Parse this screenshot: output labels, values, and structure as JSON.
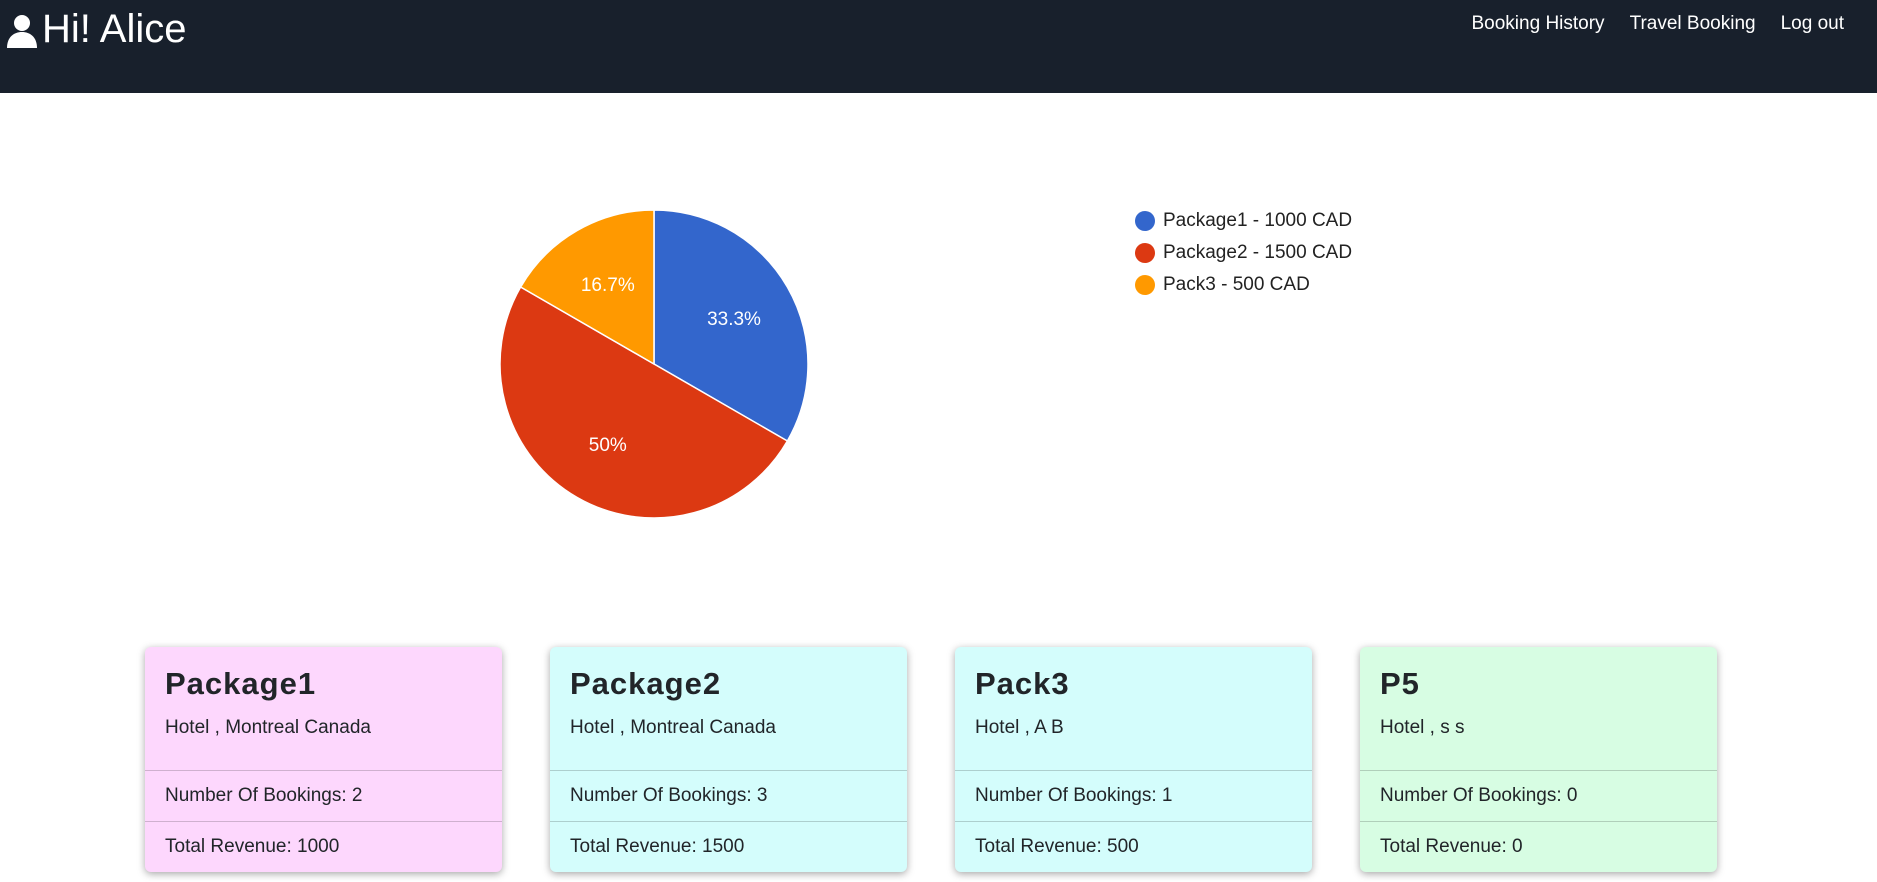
{
  "header": {
    "user_icon": "user-icon",
    "greeting": "Hi! Alice",
    "nav": [
      "Booking History",
      "Travel Booking",
      "Log out"
    ]
  },
  "chart_data": {
    "type": "pie",
    "slices": [
      {
        "label": "Package1 - 1000 CAD",
        "value": 1000,
        "pct_label": "33.3%",
        "color": "#3366cc"
      },
      {
        "label": "Package2 - 1500 CAD",
        "value": 1500,
        "pct_label": "50%",
        "color": "#dc3912"
      },
      {
        "label": "Pack3 - 500 CAD",
        "value": 500,
        "pct_label": "16.7%",
        "color": "#ff9900"
      }
    ],
    "legend_position": "right"
  },
  "cards": [
    {
      "title": "Package1",
      "subtitle": "Hotel , Montreal Canada",
      "bookings": "Number Of Bookings: 2",
      "revenue": "Total Revenue: 1000",
      "color": "#fdd7fd"
    },
    {
      "title": "Package2",
      "subtitle": "Hotel , Montreal Canada",
      "bookings": "Number Of Bookings: 3",
      "revenue": "Total Revenue: 1500",
      "color": "#d4fdfc"
    },
    {
      "title": "Pack3",
      "subtitle": "Hotel , A B",
      "bookings": "Number Of Bookings: 1",
      "revenue": "Total Revenue: 500",
      "color": "#d4fdfc"
    },
    {
      "title": "P5",
      "subtitle": "Hotel , s s",
      "bookings": "Number Of Bookings: 0",
      "revenue": "Total Revenue: 0",
      "color": "#d7fde3"
    }
  ]
}
